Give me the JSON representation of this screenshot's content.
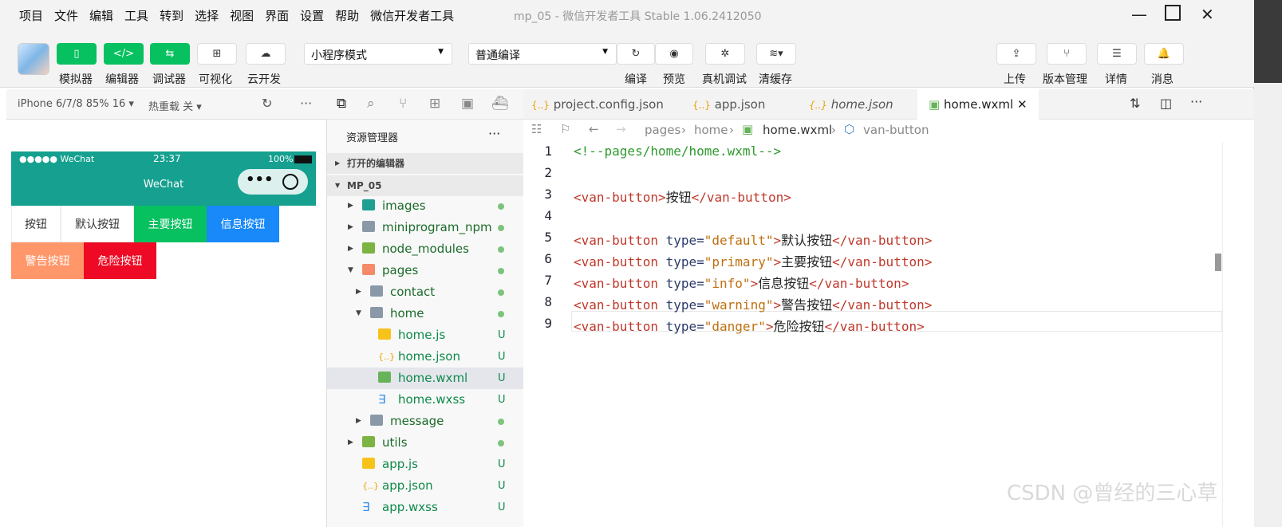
{
  "menu": [
    "项目",
    "文件",
    "编辑",
    "工具",
    "转到",
    "选择",
    "视图",
    "界面",
    "设置",
    "帮助",
    "微信开发者工具"
  ],
  "window_title": "mp_05  -  微信开发者工具 Stable 1.06.2412050",
  "toolbar": {
    "simulator": "模拟器",
    "editor": "编辑器",
    "debugger": "调试器",
    "visual": "可视化",
    "cloud": "云开发",
    "mode_select": "小程序模式",
    "compile_select": "普通编译",
    "compile": "编译",
    "preview": "预览",
    "real_debug": "真机调试",
    "clear_cache": "清缓存",
    "upload": "上传",
    "version": "版本管理",
    "details": "详情",
    "messages": "消息"
  },
  "simulator": {
    "device": "iPhone 6/7/8 85% 16 ▾",
    "hot_reload": "热重载 关 ▾",
    "status_left": "●●●●● WeChat",
    "time": "23:37",
    "battery": "100%",
    "nav_title": "WeChat",
    "buttons": [
      {
        "label": "按钮",
        "type": "plain"
      },
      {
        "label": "默认按钮",
        "type": "default"
      },
      {
        "label": "主要按钮",
        "type": "primary"
      },
      {
        "label": "信息按钮",
        "type": "info"
      },
      {
        "label": "警告按钮",
        "type": "warning"
      },
      {
        "label": "危险按钮",
        "type": "danger"
      }
    ]
  },
  "explorer": {
    "title": "资源管理器",
    "open_editors": "打开的编辑器",
    "project": "MP_05",
    "tree": [
      {
        "name": "images",
        "status": "dot"
      },
      {
        "name": "miniprogram_npm",
        "status": "dot"
      },
      {
        "name": "node_modules",
        "status": "dot"
      },
      {
        "name": "pages",
        "status": "dot"
      },
      {
        "name": "contact",
        "status": "dot"
      },
      {
        "name": "home",
        "status": "dot"
      },
      {
        "name": "home.js",
        "status": "U"
      },
      {
        "name": "home.json",
        "status": "U"
      },
      {
        "name": "home.wxml",
        "status": "U"
      },
      {
        "name": "home.wxss",
        "status": "U"
      },
      {
        "name": "message",
        "status": "dot"
      },
      {
        "name": "utils",
        "status": "dot"
      },
      {
        "name": "app.js",
        "status": "U"
      },
      {
        "name": "app.json",
        "status": "U"
      },
      {
        "name": "app.wxss",
        "status": "U"
      }
    ]
  },
  "tabs": [
    {
      "label": "project.config.json"
    },
    {
      "label": "app.json"
    },
    {
      "label": "home.json"
    },
    {
      "label": "home.wxml",
      "close": "✕"
    }
  ],
  "breadcrumb": {
    "p1": "pages",
    "p2": "home",
    "p3": "home.wxml",
    "p4": "van-button"
  },
  "code": {
    "line_numbers": [
      "1",
      "2",
      "3",
      "4",
      "5",
      "6",
      "7",
      "8",
      "9"
    ],
    "l1": "<!--pages/home/home.wxml-->",
    "l3_open": "<van-button>",
    "l3_text": "按钮",
    "l3_close": "</van-button>",
    "l5_text": "默认按钮",
    "l5_type": "\"default\"",
    "l6_text": "主要按钮",
    "l6_type": "\"primary\"",
    "l7_text": "信息按钮",
    "l7_type": "\"info\"",
    "l8_text": "警告按钮",
    "l8_type": "\"warning\"",
    "l9_text": "危险按钮",
    "l9_type": "\"danger\"",
    "open_tag": "<van-button ",
    "attr": "type=",
    "gt": ">",
    "close_tag": "</van-button>"
  },
  "watermark": "CSDN @曾经的三心草",
  "colors": {
    "green": "#07c160",
    "info": "#1989fa",
    "warning": "#ff976a",
    "danger": "#ee0a24",
    "nav": "#15a08f"
  }
}
